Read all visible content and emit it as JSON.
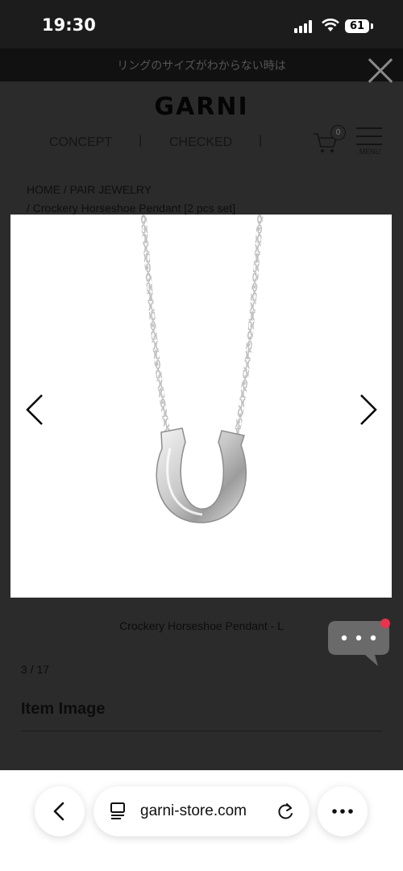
{
  "status": {
    "time": "19:30",
    "battery": "61"
  },
  "banner": {
    "text": "リングのサイズがわからない時は"
  },
  "header": {
    "logo": "GARNI",
    "nav": [
      "CONCEPT",
      "CHECKED"
    ],
    "separator": "|",
    "cart_count": "0",
    "menu_label": "MENU"
  },
  "breadcrumb": {
    "home": "HOME",
    "separator": "/",
    "category": "PAIR JEWELRY",
    "current": "/ Crockery Horseshoe Pendant [2 pcs set]"
  },
  "product": {
    "image_alt": "silver horseshoe pendant on chain",
    "caption": "Crockery Horseshoe Pendant - L",
    "counter": "3 / 17",
    "section_title": "Item Image"
  },
  "browser": {
    "url": "garni-store.com"
  },
  "colors": {
    "chat_badge": "#e8344d",
    "page_overlay": "#2b2b2b",
    "chat_bubble": "#6a6a6a"
  }
}
